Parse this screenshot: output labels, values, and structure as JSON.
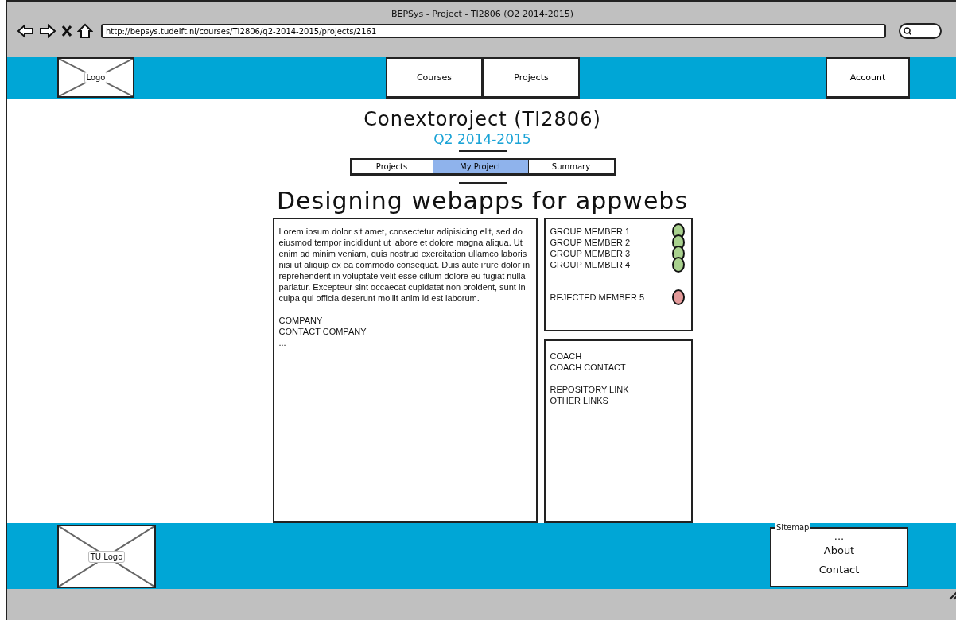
{
  "window": {
    "title": "BEPSys - Project - TI2806 (Q2 2014-2015)"
  },
  "address_bar": {
    "value": "http://bepsys.tudelft.nl/courses/TI2806/q2-2014-2015/projects/2161"
  },
  "nav": {
    "logo": "Logo",
    "items": [
      {
        "label": "Courses"
      },
      {
        "label": "Projects"
      }
    ],
    "account": "Account"
  },
  "header": {
    "title": "Conextoroject (TI2806)",
    "subtitle": "Q2 2014-2015"
  },
  "tabs": [
    {
      "label": "Projects",
      "selected": false
    },
    {
      "label": "My Project",
      "selected": true
    },
    {
      "label": "Summary",
      "selected": false
    }
  ],
  "project_title": "Designing webapps for appwebs",
  "description": {
    "text": "Lorem ipsum dolor sit amet, consectetur adipisicing elit, sed do eiusmod tempor incididunt ut labore et dolore magna aliqua. Ut enim ad minim veniam, quis nostrud exercitation ullamco laboris nisi ut aliquip ex ea commodo consequat. Duis aute irure dolor in reprehenderit in voluptate velit esse cillum dolore eu fugiat nulla pariatur. Excepteur sint occaecat cupidatat non proident, sunt in culpa qui officia deserunt mollit anim id est laborum.",
    "lines": [
      "COMPANY",
      "CONTACT COMPANY",
      "..."
    ]
  },
  "members": [
    {
      "name": "GROUP MEMBER 1",
      "kind": "accepted",
      "color": "#a9d18e"
    },
    {
      "name": "GROUP MEMBER 2",
      "kind": "accepted",
      "color": "#a9d18e"
    },
    {
      "name": "GROUP MEMBER 3",
      "kind": "accepted",
      "color": "#a9d18e"
    },
    {
      "name": "GROUP MEMBER 4",
      "kind": "accepted",
      "color": "#a9d18e"
    },
    {
      "name": "REJECTED MEMBER 5",
      "kind": "rejected",
      "color": "#e39a9a"
    }
  ],
  "links": [
    {
      "lines": [
        "COACH",
        "COACH CONTACT"
      ]
    },
    {
      "lines": [
        "REPOSITORY LINK",
        "OTHER LINKS"
      ]
    }
  ],
  "footer": {
    "logo": "TU Logo",
    "sitemap": {
      "title": "Sitemap",
      "items": [
        "...",
        "About",
        "Contact"
      ]
    }
  }
}
